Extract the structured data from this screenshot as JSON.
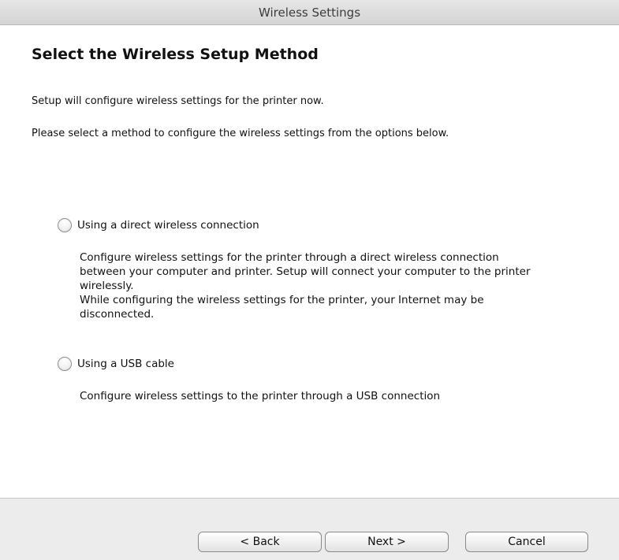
{
  "window": {
    "title": "Wireless Settings"
  },
  "page": {
    "title": "Select the Wireless Setup Method",
    "intro_1": "Setup will configure wireless settings for the printer now.",
    "intro_2": "Please select a method to configure the wireless settings from the options below."
  },
  "options": [
    {
      "label": "Using a direct wireless connection",
      "selected": false,
      "description_lines": [
        "Configure wireless settings for the printer through a direct wireless connection",
        "between your computer and printer. Setup will connect your computer to the printer",
        "wirelessly.",
        "While configuring the wireless settings for the printer, your Internet may be",
        "disconnected."
      ]
    },
    {
      "label": "Using a USB cable",
      "selected": false,
      "description_lines": [
        "Configure wireless settings to the printer through a USB connection"
      ]
    }
  ],
  "buttons": {
    "back": "< Back",
    "next": "Next >",
    "cancel": "Cancel"
  }
}
